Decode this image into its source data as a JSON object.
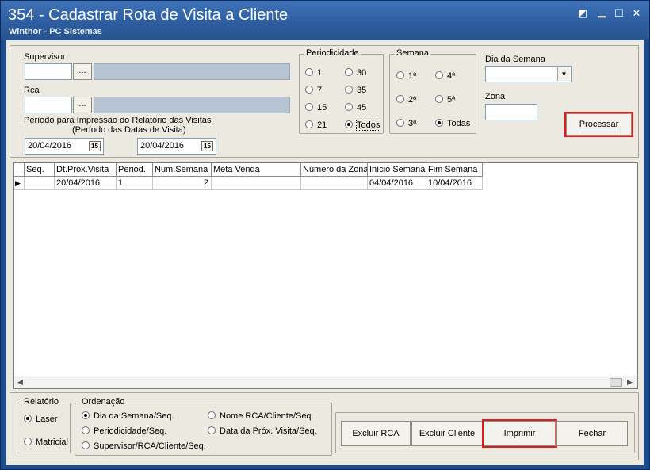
{
  "window": {
    "title": "354 - Cadastrar Rota de Visita a Cliente",
    "subtitle": "Winthor - PC Sistemas"
  },
  "filters": {
    "supervisor_label": "Supervisor",
    "supervisor_code": "",
    "supervisor_name": "",
    "lookup_button": "...",
    "rca_label": "Rca",
    "rca_code": "",
    "rca_name": "",
    "period_label_line1": "Período para Impressão do Relatório das Visitas",
    "period_label_line2": "(Período das Datas de Visita)",
    "date_start": "20/04/2016",
    "date_end": "20/04/2016",
    "calendar_icon_text": "15"
  },
  "periodicidade": {
    "title": "Periodicidade",
    "options": [
      "1",
      "30",
      "7",
      "35",
      "15",
      "45",
      "21",
      "Todos"
    ],
    "selected": "Todos"
  },
  "semana": {
    "title": "Semana",
    "options": [
      "1ª",
      "4ª",
      "2ª",
      "5ª",
      "3ª",
      "Todas"
    ],
    "selected": "Todas"
  },
  "dia_semana": {
    "label": "Dia da Semana",
    "value": ""
  },
  "zona": {
    "label": "Zona",
    "value": ""
  },
  "processar_button": "Processar",
  "grid": {
    "columns": [
      "Seq.",
      "Dt.Próx.Visita",
      "Period.",
      "Num.Semana",
      "Meta Venda",
      "Número da Zona",
      "Início Semana",
      "Fim Semana"
    ],
    "rows": [
      [
        "",
        "20/04/2016",
        "1",
        "2",
        "",
        "",
        "04/04/2016",
        "10/04/2016"
      ]
    ]
  },
  "relatorio": {
    "title": "Relatório",
    "options": [
      "Laser",
      "Matricial"
    ],
    "selected": "Laser"
  },
  "ordenacao": {
    "title": "Ordenação",
    "options": [
      "Dia da Semana/Seq.",
      "Nome RCA/Cliente/Seq.",
      "Periodicidade/Seq.",
      "Data da Próx. Visita/Seq.",
      "Supervisor/RCA/Cliente/Seq."
    ],
    "selected": "Dia da Semana/Seq."
  },
  "actions": {
    "excluir_rca": "Excluir RCA",
    "excluir_cliente": "Excluir Cliente",
    "imprimir": "Imprimir",
    "fechar": "Fechar"
  },
  "colors": {
    "titlebar": "#2d5c9e",
    "highlight": "#e01b1b",
    "readonly_field": "#b7c4d4"
  }
}
